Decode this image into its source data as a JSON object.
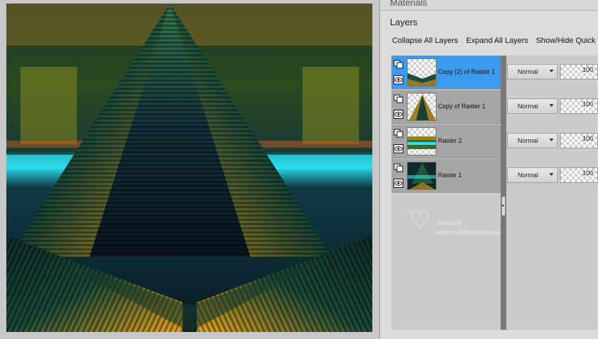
{
  "panel": {
    "materials_title": "Materials",
    "layers_title": "Layers",
    "toolbar": {
      "collapse_label": "Collapse All Layers",
      "expand_label": "Expand All Layers",
      "showhide_label": "Show/Hide Quick"
    }
  },
  "layers": [
    {
      "name": "Copy (2) of Raster 1",
      "blend": "Normal",
      "opacity": "100",
      "selected": true
    },
    {
      "name": "Copy of Raster 1",
      "blend": "Normal",
      "opacity": "100",
      "selected": false
    },
    {
      "name": "Raster 2",
      "blend": "Normal",
      "opacity": "100",
      "selected": false
    },
    {
      "name": "Raster 1",
      "blend": "Normal",
      "opacity": "100",
      "selected": false
    }
  ],
  "watermark": {
    "name": "Pinuccia",
    "url": "www.maidiregrafica.eu"
  },
  "colors": {
    "selected_row": "#3d9bef",
    "row": "#a6a6a6",
    "canvas_dark": "#0b1420",
    "gold": "#e0a020",
    "teal": "#2aa7a0",
    "cyan": "#2fe0f0"
  },
  "icons": [
    "layer-visibility-icon",
    "eye-icon",
    "chevron-down-icon",
    "splitter-arrow-icon",
    "heart-logo-icon"
  ]
}
